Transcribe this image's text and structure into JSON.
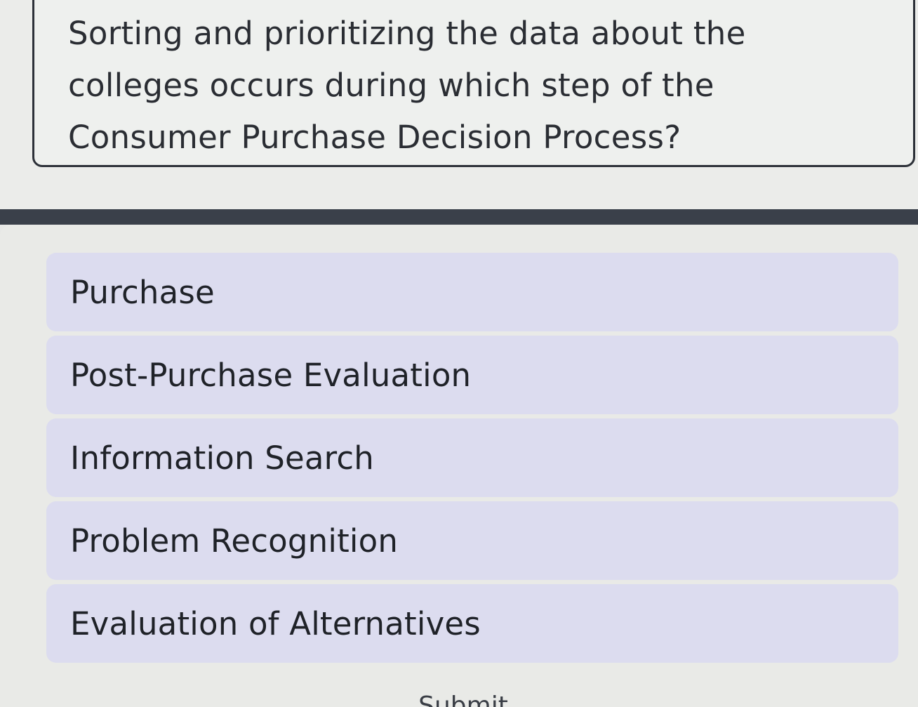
{
  "question": {
    "text": "Sorting and prioritizing the data about the colleges occurs during which step of the Consumer Purchase Decision Process?"
  },
  "options": [
    {
      "label": "Purchase"
    },
    {
      "label": "Post-Purchase Evaluation"
    },
    {
      "label": "Information Search"
    },
    {
      "label": "Problem Recognition"
    },
    {
      "label": "Evaluation of Alternatives"
    }
  ],
  "submit": {
    "label": "Submit"
  },
  "colors": {
    "option_background": "#dcdcef",
    "divider": "#3a404a",
    "card_border": "#2c3038"
  }
}
